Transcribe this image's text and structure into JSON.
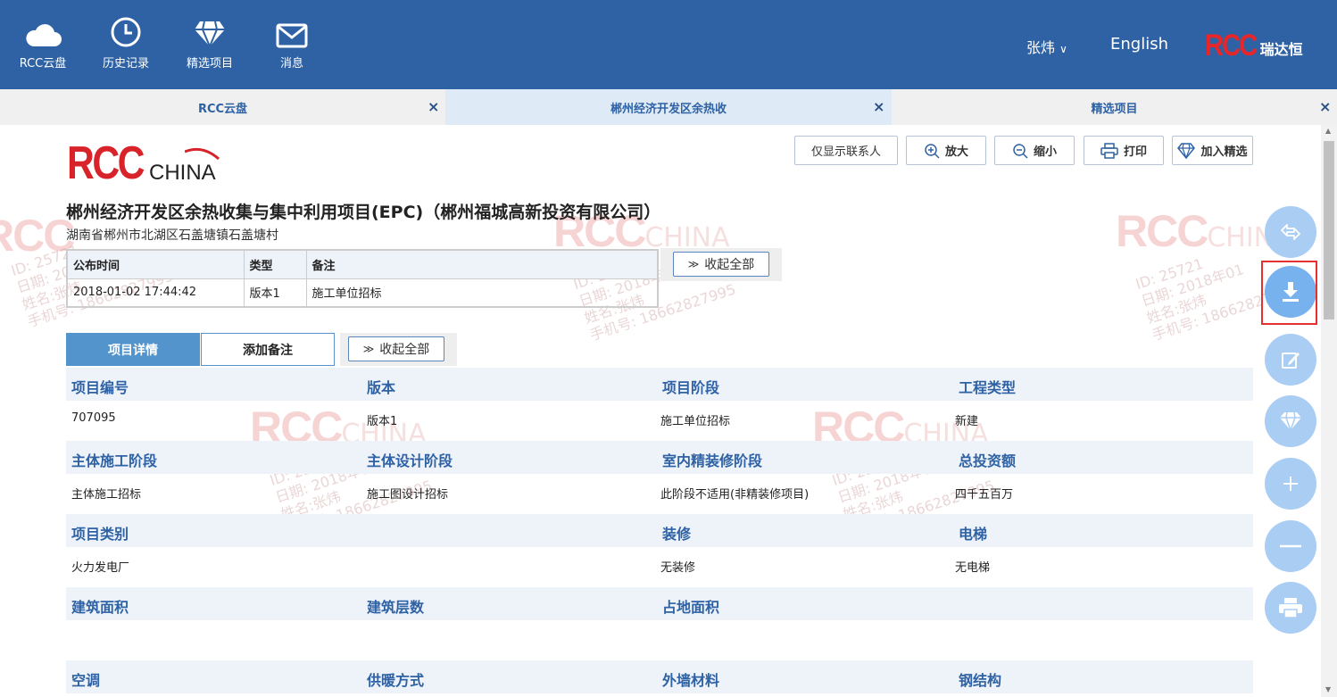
{
  "nav": [
    {
      "label": "RCC云盘",
      "icon": "cloud-icon"
    },
    {
      "label": "历史记录",
      "icon": "clock-icon"
    },
    {
      "label": "精选项目",
      "icon": "diamond-icon"
    },
    {
      "label": "消息",
      "icon": "mail-icon"
    }
  ],
  "header": {
    "user": "张炜",
    "language": "English",
    "logo_text": "RCC",
    "logo_cn": "瑞达恒"
  },
  "tabs": [
    {
      "label": "RCC云盘",
      "close": "×"
    },
    {
      "label": "郴州经济开发区余热收",
      "close": "×"
    },
    {
      "label": "精选项目",
      "close": "×"
    }
  ],
  "toolbar": {
    "contacts_only": "仅显示联系人",
    "zoom_in": "放大",
    "zoom_out": "缩小",
    "print": "打印",
    "add_featured": "加入精选"
  },
  "logo": {
    "rcc": "RCC",
    "china": "CHINA"
  },
  "project": {
    "title": "郴州经济开发区余热收集与集中利用项目(EPC)（郴州福城高新投资有限公司）",
    "address": "湖南省郴州市北湖区石盖塘镇石盖塘村"
  },
  "publish_table": {
    "headers": [
      "公布时间",
      "类型",
      "备注"
    ],
    "rows": [
      [
        "2018-01-02 17:44:42",
        "版本1",
        "施工单位招标"
      ]
    ]
  },
  "collapse_all": "收起全部",
  "detail_tabs": {
    "details": "项目详情",
    "add_note": "添加备注"
  },
  "details": [
    {
      "labels": [
        "项目编号",
        "版本",
        "项目阶段",
        "工程类型"
      ],
      "values": [
        "707095",
        "版本1",
        "施工单位招标",
        "新建"
      ]
    },
    {
      "labels": [
        "主体施工阶段",
        "主体设计阶段",
        "室内精装修阶段",
        "总投资额"
      ],
      "values": [
        "主体施工招标",
        "施工图设计招标",
        "此阶段不适用(非精装修项目)",
        "四千五百万"
      ]
    },
    {
      "labels": [
        "项目类别",
        "",
        "装修",
        "电梯"
      ],
      "values": [
        "火力发电厂",
        "",
        "无装修",
        "无电梯"
      ]
    },
    {
      "labels": [
        "建筑面积",
        "建筑层数",
        "占地面积",
        ""
      ],
      "values": [
        "",
        "",
        "",
        ""
      ]
    },
    {
      "labels": [
        "空调",
        "供暖方式",
        "外墙材料",
        "钢结构"
      ],
      "values": [
        "",
        "",
        "",
        ""
      ]
    }
  ],
  "watermark": {
    "rcc": "RCC",
    "china": "CHINA",
    "id": "ID: 25721",
    "date": "日期: 2018年01",
    "name": "姓名:张炜",
    "phone": "手机号: 18662827995"
  },
  "colors": {
    "header_bg": "#2e62a4",
    "accent": "#2e62a4",
    "logo_red": "#d9232b",
    "highlight": "#e53030"
  }
}
